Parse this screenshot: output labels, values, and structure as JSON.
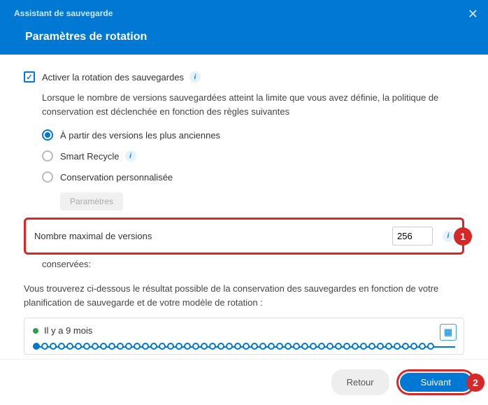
{
  "header": {
    "title": "Assistant de sauvegarde",
    "subtitle": "Paramètres de rotation",
    "close": "✕"
  },
  "enable": {
    "label": "Activer la rotation des sauvegardes"
  },
  "description": "Lorsque le nombre de versions sauvegardées atteint la limite que vous avez définie, la politique de conservation est déclenchée en fonction des règles suivantes",
  "radios": {
    "r1": "À partir des versions les plus anciennes",
    "r2": "Smart Recycle",
    "r3": "Conservation personnalisée"
  },
  "params_btn": "Paramètres",
  "max": {
    "label": "Nombre maximal de versions",
    "value": "256",
    "badge": "1"
  },
  "kept": "conservées:",
  "result_desc": "Vous trouverez ci-dessous le résultat possible de la conservation des sauvegardes en fonction de votre planification de sauvegarde et de votre modèle de rotation :",
  "timeline": {
    "ago": "Il y a 9 mois"
  },
  "footer": {
    "back": "Retour",
    "next": "Suivant",
    "next_badge": "2"
  },
  "info_glyph": "i"
}
